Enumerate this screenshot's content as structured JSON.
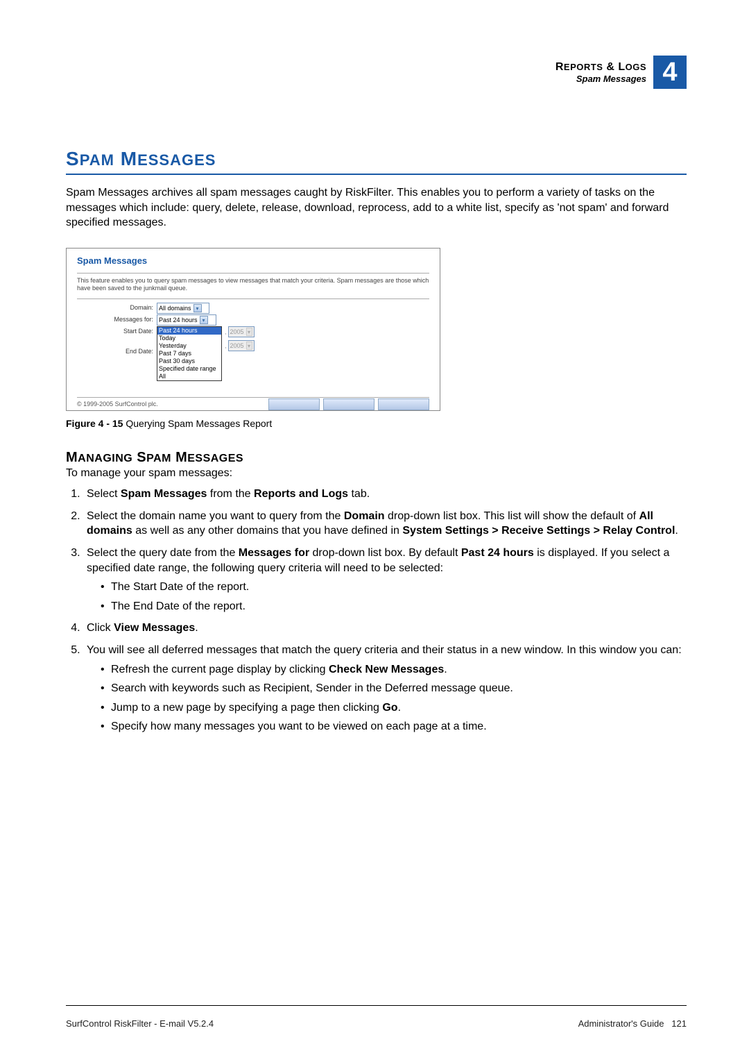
{
  "header": {
    "category_main": "R",
    "category_rest": "EPORTS",
    "category_amp": " & L",
    "category_rest2": "OGS",
    "subtitle": "Spam Messages",
    "chapter_number": "4"
  },
  "section_title": {
    "a": "S",
    "b": "PAM",
    "c": " M",
    "d": "ESSAGES"
  },
  "intro": "Spam Messages archives all spam messages caught by RiskFilter. This enables you to perform a variety of tasks on the messages which include: query, delete, release, download, reprocess, add to a white list, specify as 'not spam' and forward specified messages.",
  "screenshot": {
    "panel_title": "Spam Messages",
    "panel_desc": "This feature enables you to query spam messages to view messages that match your criteria. Spam messages are those which have been saved to the junkmail queue.",
    "labels": {
      "domain": "Domain:",
      "messages_for": "Messages for:",
      "start_date": "Start Date:",
      "end_date": "End Date:"
    },
    "values": {
      "domain": "All domains",
      "messages_for_selected": "Past 24 hours",
      "year": "2005"
    },
    "dropdown_options": [
      "Past 24 hours",
      "Today",
      "Yesterday",
      "Past 7 days",
      "Past 30 days",
      "Specified date range",
      "All"
    ],
    "copyright": "© 1999-2005 SurfControl plc.",
    "buttons": {
      "b1": " ",
      "b2": " ",
      "b3": " "
    }
  },
  "figure": {
    "label": "Figure 4 - 15",
    "caption": " Querying Spam Messages Report"
  },
  "subsection_title": {
    "a": "M",
    "b": "ANAGING",
    "c": " S",
    "d": "PAM",
    "e": " M",
    "f": "ESSAGES"
  },
  "lead": "To manage your spam messages:",
  "steps": [
    {
      "pre": "Select ",
      "b1": "Spam Messages",
      "mid": " from the ",
      "b2": "Reports and Logs",
      "post": " tab."
    },
    {
      "pre": "Select the domain name you want to query from the ",
      "b1": "Domain",
      "mid": " drop-down list box. This list will show the default of ",
      "b2": "All domains",
      "mid2": " as well as any other domains that you have defined in ",
      "b3": "System Settings > Receive Settings > Relay Control",
      "post": "."
    },
    {
      "pre": "Select the query date from the ",
      "b1": "Messages for",
      "mid": " drop-down list box. By default ",
      "b2": "Past 24 hours",
      "post": " is displayed. If you select a specified date range, the following query criteria will need to be selected:",
      "sub": [
        "The Start Date of the report.",
        "The End Date of the report."
      ]
    },
    {
      "pre": "Click ",
      "b1": "View Messages",
      "post": "."
    },
    {
      "pre": "You will see all deferred messages that match the query criteria and their status in a new window. In this window you can:",
      "sub_rich": [
        {
          "pre": "Refresh the current page display by clicking ",
          "b": "Check New Messages",
          "post": "."
        },
        {
          "pre": "Search with keywords such as Recipient, Sender in the Deferred message queue."
        },
        {
          "pre": "Jump to a new page by specifying a page then clicking ",
          "b": "Go",
          "post": "."
        },
        {
          "pre": "Specify how many messages you want to be viewed on each page at a time."
        }
      ]
    }
  ],
  "footer": {
    "left": "SurfControl RiskFilter - E-mail V5.2.4",
    "right_label": "Administrator's Guide",
    "page": "121"
  }
}
